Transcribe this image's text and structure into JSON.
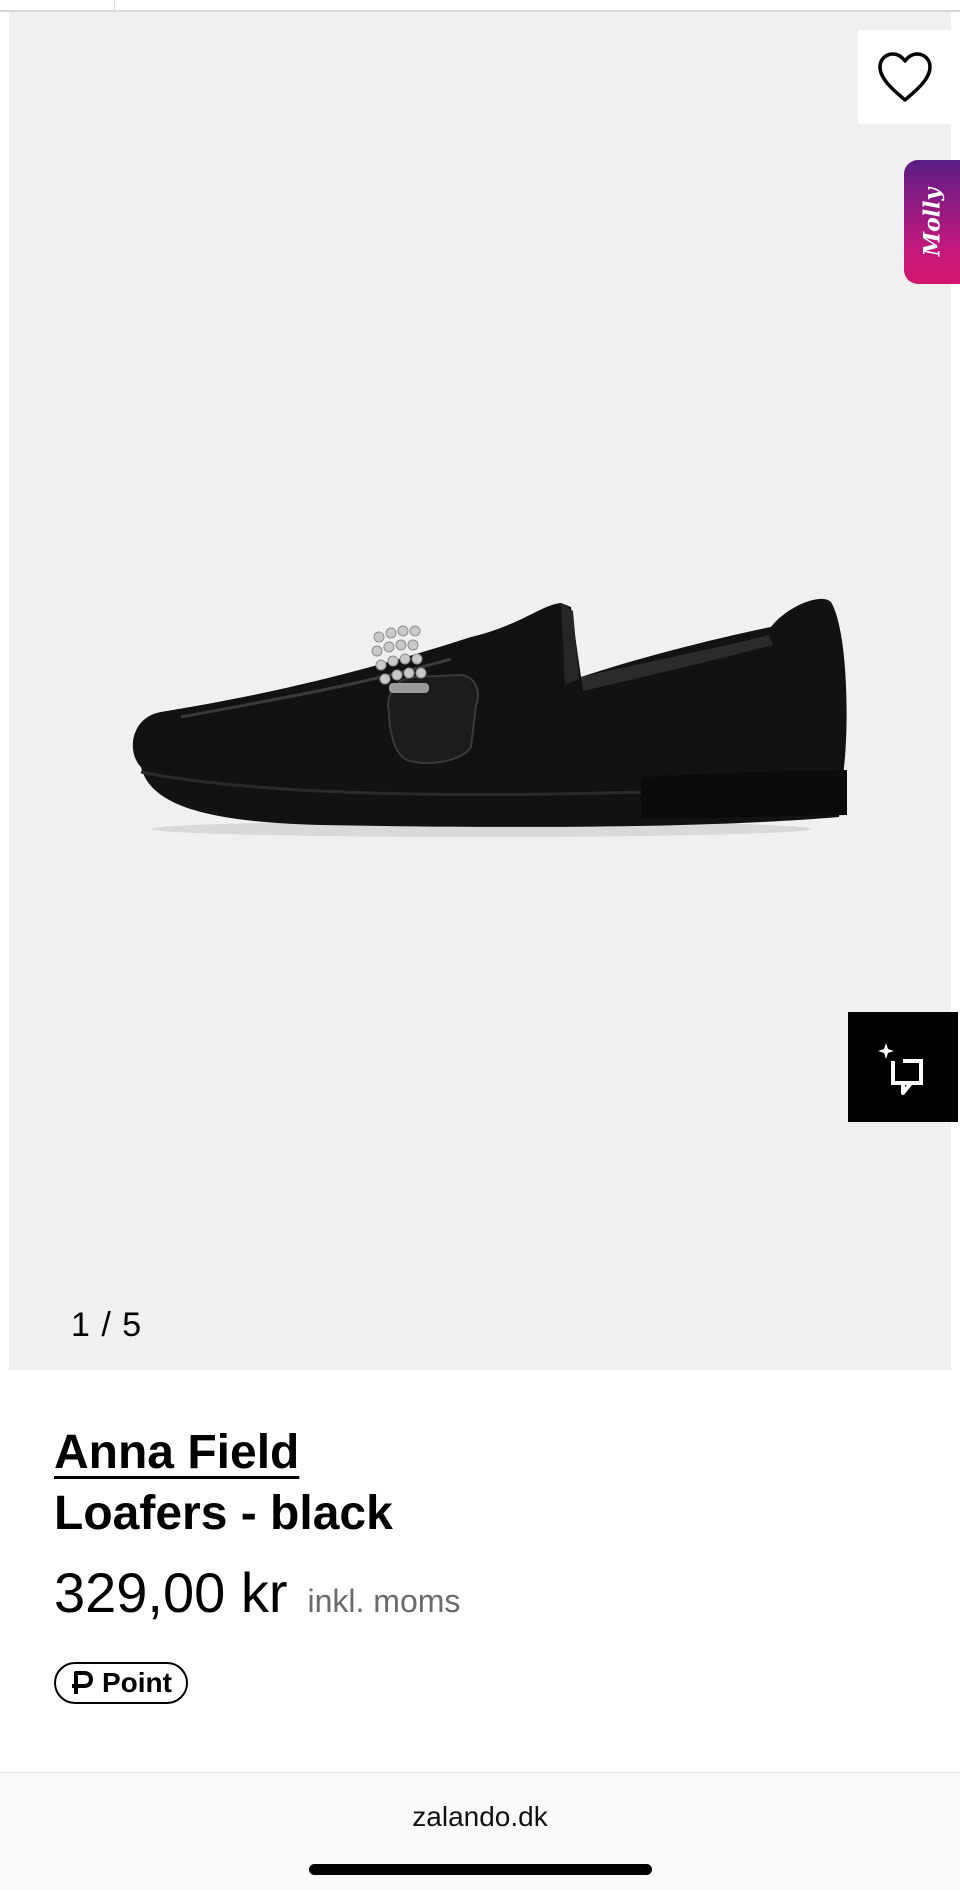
{
  "gallery": {
    "counter": "1 / 5",
    "wishlist_icon": "heart-icon",
    "assistant_tab_label": "Molly",
    "ai_button_icon": "sparkle-crop-icon"
  },
  "product": {
    "brand": "Anna Field",
    "name": "Loafers - black",
    "price": "329,00 kr",
    "vat_note": "inkl. moms",
    "points_label": "Point",
    "points_icon": "p-coin-icon"
  },
  "browser": {
    "url": "zalando.dk"
  },
  "colors": {
    "gallery_bg": "#f0f0f0",
    "molly_gradient_start": "#5b1d86",
    "molly_gradient_end": "#d4156f",
    "vat_text": "#6b6b6b"
  }
}
